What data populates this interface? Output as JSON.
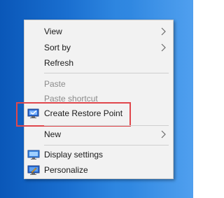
{
  "context_menu": {
    "items": [
      {
        "label": "View",
        "has_submenu": true
      },
      {
        "label": "Sort by",
        "has_submenu": true
      },
      {
        "label": "Refresh",
        "has_submenu": false
      },
      {
        "label": "Paste",
        "disabled": true
      },
      {
        "label": "Paste shortcut",
        "disabled": true
      },
      {
        "label": "Create Restore Point",
        "icon": "restore-point-icon"
      },
      {
        "label": "New",
        "has_submenu": true
      },
      {
        "label": "Display settings",
        "icon": "display-settings-icon"
      },
      {
        "label": "Personalize",
        "icon": "personalize-icon"
      }
    ],
    "highlighted_item": "Create Restore Point"
  },
  "colors": {
    "desktop_background": "#1a6fd0",
    "menu_background": "#f2f2f2",
    "highlight_border": "#e0474c",
    "disabled_text": "#8b8b8b"
  }
}
